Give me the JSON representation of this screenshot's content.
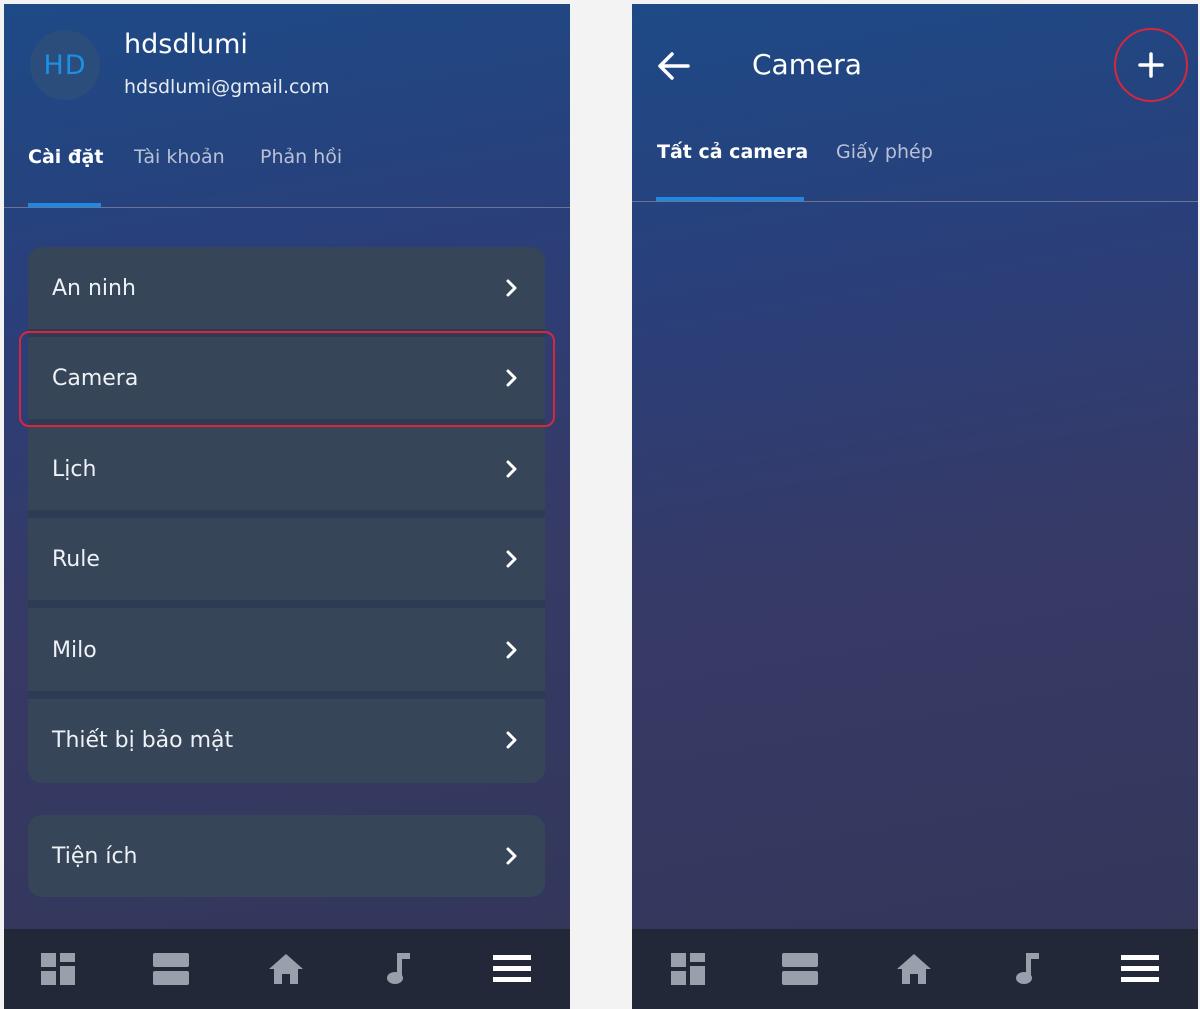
{
  "left_screen": {
    "profile": {
      "avatar_initials": "HD",
      "name": "hdsdlumi",
      "email": "hdsdlumi@gmail.com"
    },
    "tabs": [
      {
        "label": "Cài đặt",
        "active": true
      },
      {
        "label": "Tài khoản",
        "active": false
      },
      {
        "label": "Phản hồi",
        "active": false
      }
    ],
    "menu_group_1": [
      {
        "label": "An ninh"
      },
      {
        "label": "Camera",
        "highlighted": true
      },
      {
        "label": "Lịch"
      },
      {
        "label": "Rule"
      },
      {
        "label": "Milo"
      },
      {
        "label": "Thiết bị bảo mật"
      }
    ],
    "menu_group_2": [
      {
        "label": "Tiện ích"
      }
    ]
  },
  "right_screen": {
    "title": "Camera",
    "tabs": [
      {
        "label": "Tất cả camera",
        "active": true
      },
      {
        "label": "Giấy phép",
        "active": false
      }
    ]
  },
  "bottom_nav": {
    "icons": [
      "dashboard-icon",
      "rooms-icon",
      "home-icon",
      "music-icon",
      "menu-icon"
    ]
  },
  "colors": {
    "accent": "#1e88e5",
    "highlight": "#d8263d",
    "card": "#364557",
    "nav_bar": "#222838"
  }
}
